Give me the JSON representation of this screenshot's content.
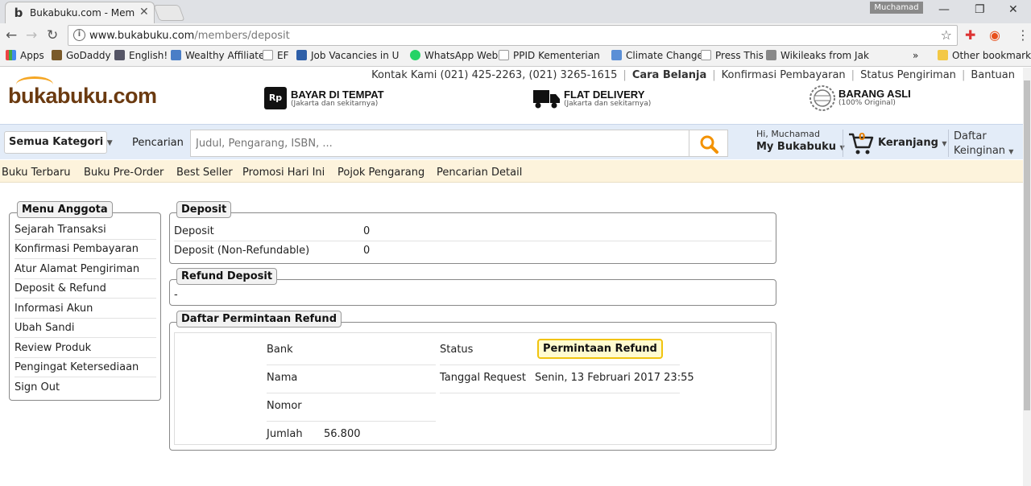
{
  "browser": {
    "tab_title": "Bukabuku.com - Members",
    "profile_name": "Muchamad",
    "url_host": "www.bukabuku.com",
    "url_path": "/members/deposit",
    "bookmarks": [
      "Apps",
      "GoDaddy",
      "English!",
      "Wealthy Affiliate",
      "EF",
      "Job Vacancies in United",
      "WhatsApp Web",
      "PPID Kementerian Kesehatan",
      "Climate Change",
      "Press This",
      "Wikileaks from Jakarta",
      "»",
      "Other bookmarks"
    ],
    "icons": {
      "back": "back-arrow-icon",
      "forward": "forward-arrow-icon",
      "reload": "reload-icon",
      "star": "star-icon"
    }
  },
  "site": {
    "top_links": [
      "Kontak Kami (021) 425-2263, (021) 3265-1615",
      "Cara Belanja",
      "Konfirmasi Pembayaran",
      "Status Pengiriman",
      "Bantuan"
    ],
    "logo": "bukabuku.com",
    "features": [
      {
        "icon": "Rp",
        "title": "BAYAR DI TEMPAT",
        "sub": "(Jakarta dan sekitarnya)"
      },
      {
        "icon": "truck",
        "title": "FLAT DELIVERY",
        "sub": "(Jakarta dan sekitarnya)"
      },
      {
        "icon": "seal",
        "title": "BARANG ASLI",
        "sub": "(100% Original)"
      }
    ],
    "search": {
      "category_label": "Semua Kategori",
      "label": "Pencarian",
      "placeholder": "Judul, Pengarang, ISBN, ..."
    },
    "user": {
      "greeting": "Hi, Muchamad",
      "account_label": "My Bukabuku"
    },
    "cart": {
      "count": "0",
      "label": "Keranjang"
    },
    "wishlist": {
      "line1": "Daftar",
      "line2": "Keinginan"
    },
    "nav": [
      "Buku Terbaru",
      "Buku Pre-Order",
      "Best Seller",
      "Promosi Hari Ini",
      "Pojok Pengarang",
      "Pencarian Detail"
    ]
  },
  "member_menu": {
    "title": "Menu Anggota",
    "items": [
      "Sejarah Transaksi",
      "Konfirmasi Pembayaran",
      "Atur Alamat Pengiriman",
      "Deposit & Refund",
      "Informasi Akun",
      "Ubah Sandi",
      "Review Produk",
      "Pengingat Ketersediaan",
      "Sign Out"
    ]
  },
  "deposit": {
    "title": "Deposit",
    "rows": [
      {
        "label": "Deposit",
        "value": "0"
      },
      {
        "label": "Deposit (Non-Refundable)",
        "value": "0"
      }
    ]
  },
  "refund_deposit": {
    "title": "Refund Deposit",
    "value": "-"
  },
  "refund_requests": {
    "title": "Daftar Permintaan Refund",
    "fields": {
      "bank_label": "Bank",
      "nama_label": "Nama",
      "nomor_label": "Nomor",
      "jumlah_label": "Jumlah",
      "jumlah_value": "56.800",
      "status_label": "Status",
      "status_value": "Permintaan Refund",
      "tanggal_label": "Tanggal Request",
      "tanggal_value": "Senin, 13 Februari 2017 23:55"
    }
  }
}
